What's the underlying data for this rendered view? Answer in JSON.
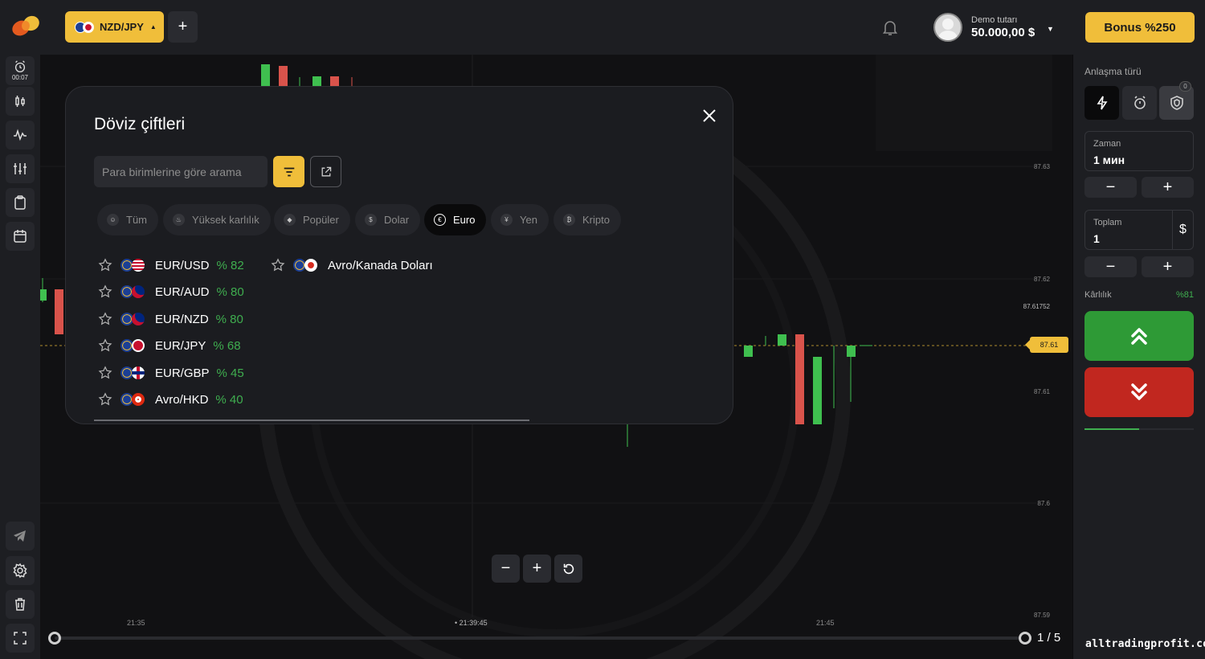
{
  "topbar": {
    "pair_label": "NZD/JPY",
    "add_pair_symbol": "+",
    "demo_label": "Demo tutarı",
    "demo_value": "50.000,00 $",
    "bonus_label": "Bonus %250"
  },
  "sidebar": {
    "timer": "00:07",
    "icons": [
      "alarm-icon",
      "candles-icon",
      "indicator-icon",
      "sliders-icon",
      "clipboard-icon",
      "calendar-icon",
      "telegram-icon",
      "settings-icon",
      "trash-icon",
      "fullscreen-icon"
    ]
  },
  "chart": {
    "price_labels": [
      "87.63",
      "87.62",
      "87.61752",
      "87.61",
      "87.6",
      "87.59"
    ],
    "current_price": "87.61",
    "time_labels": [
      "21:35",
      "• 21:39:45",
      "21:45"
    ],
    "zoom_out": "−",
    "zoom_in": "+",
    "page": "1 / 5"
  },
  "modal": {
    "title": "Döviz çiftleri",
    "search_placeholder": "Para birimlerine göre arama",
    "tabs": [
      {
        "label": "Tüm",
        "icon": "☺"
      },
      {
        "label": "Yüksek karlılık",
        "icon": "♨"
      },
      {
        "label": "Popüler",
        "icon": "◆"
      },
      {
        "label": "Dolar",
        "icon": "$"
      },
      {
        "label": "Euro",
        "icon": "€"
      },
      {
        "label": "Yen",
        "icon": "¥"
      },
      {
        "label": "Kripto",
        "icon": "₿"
      }
    ],
    "active_tab": "Euro",
    "pairs": [
      {
        "name": "EUR/USD",
        "profit": "% 82"
      },
      {
        "name": "EUR/AUD",
        "profit": "% 80"
      },
      {
        "name": "EUR/NZD",
        "profit": "% 80"
      },
      {
        "name": "EUR/JPY",
        "profit": "% 68"
      },
      {
        "name": "EUR/GBP",
        "profit": "% 45"
      },
      {
        "name": "Avro/HKD",
        "profit": "% 40"
      },
      {
        "name": "Avro/Kanada Doları",
        "profit": ""
      }
    ]
  },
  "rpanel": {
    "deal_type_label": "Anlaşma türü",
    "badge": "0",
    "time_label": "Zaman",
    "time_value": "1 мин",
    "minus": "−",
    "plus": "+",
    "amount_label": "Toplam",
    "amount_value": "1",
    "currency": "$",
    "profit_label": "Kârlılık",
    "profit_value": "%81"
  },
  "watermark": "alltradingprofit.com",
  "colors": {
    "accent": "#f0be3a",
    "up": "#2e9a36",
    "down": "#c1271f",
    "profit": "#3fae4f"
  }
}
